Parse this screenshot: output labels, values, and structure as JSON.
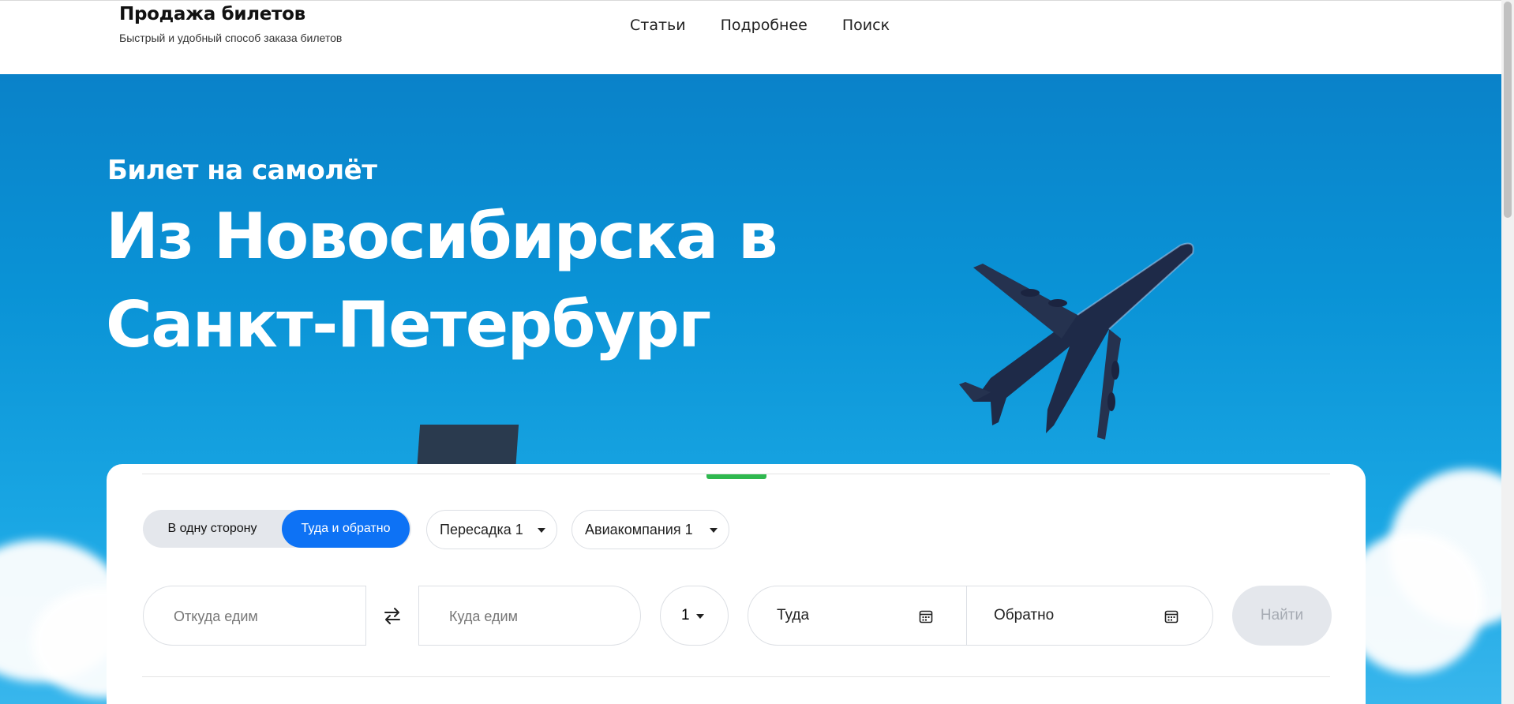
{
  "header": {
    "title": "Продажа билетов",
    "subtitle": "Быстрый и удобный способ заказа билетов",
    "nav": [
      "Статьи",
      "Подробнее",
      "Поиск"
    ]
  },
  "hero": {
    "kicker": "Билет на самолёт",
    "headline": "Из Новосибирска в Санкт-Петербург"
  },
  "search": {
    "trip_types": [
      "В одну сторону",
      "Туда и обратно"
    ],
    "selected_trip_type": "Туда и обратно",
    "transfer_label": "Пересадка 1",
    "airline_label": "Авиакомпания 1",
    "from_placeholder": "Откуда едим",
    "to_placeholder": "Куда едим",
    "passengers_value": "1",
    "depart_label": "Туда",
    "return_label": "Обратно",
    "submit_label": "Найти"
  },
  "colors": {
    "accent": "#0d72f5",
    "indicator": "#2fb84f",
    "sky": "#0a93d6"
  }
}
